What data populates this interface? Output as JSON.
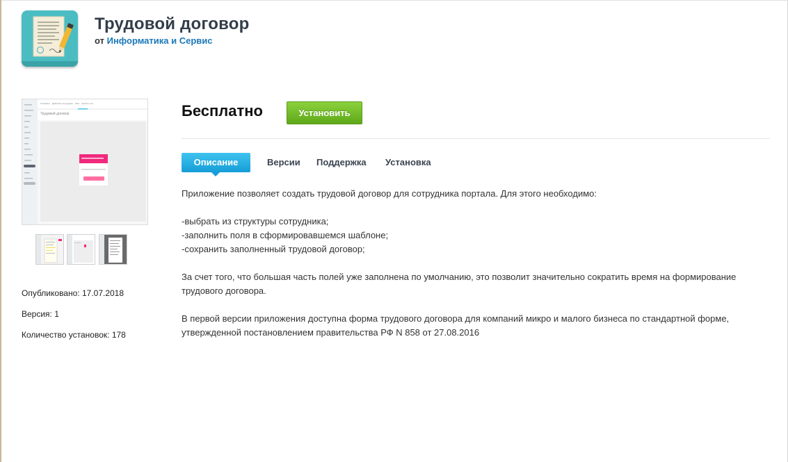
{
  "header": {
    "title": "Трудовой договор",
    "vendor_prefix": "от",
    "vendor_name": "Информатика и Сервис",
    "icon": "contract-document-pen-icon"
  },
  "gallery": {
    "mini_tabs": [
      "Основное",
      "Действия сотрудника",
      "Мои",
      "Пройти тест"
    ],
    "mini_title": "Трудовой договор",
    "thumb_count": 3
  },
  "meta": {
    "published_label": "Опубликовано:",
    "published_value": "17.07.2018",
    "version_label": "Версия:",
    "version_value": "1",
    "installs_label": "Количество установок:",
    "installs_value": "178"
  },
  "purchase": {
    "price": "Бесплатно",
    "install_label": "Установить"
  },
  "tabs": [
    {
      "label": "Описание",
      "active": true
    },
    {
      "label": "Версии",
      "active": false
    },
    {
      "label": "Поддержка",
      "active": false
    },
    {
      "label": "Установка",
      "active": false
    }
  ],
  "description": {
    "intro": "Приложение позволяет создать трудовой договор для сотрудника портала. Для этого необходимо:",
    "steps": [
      "-выбрать из структуры сотрудника;",
      "-заполнить поля в сформировавшемся шаблоне;",
      "-сохранить заполненный трудовой договор;"
    ],
    "para2": "За счет того, что большая часть полей уже заполнена по умолчанию, это позволит значительно сократить время на формирование трудового договора.",
    "para3": "В первой версии приложения доступна форма трудового договора для компаний микро и малого бизнеса по стандартной форме, утвержденной постановлением правительства РФ N 858 от 27.08.2016"
  },
  "colors": {
    "accent_blue": "#159dd6",
    "install_green": "#5ea819",
    "vendor_link": "#1b78b8",
    "icon_teal": "#4bbdc2"
  }
}
